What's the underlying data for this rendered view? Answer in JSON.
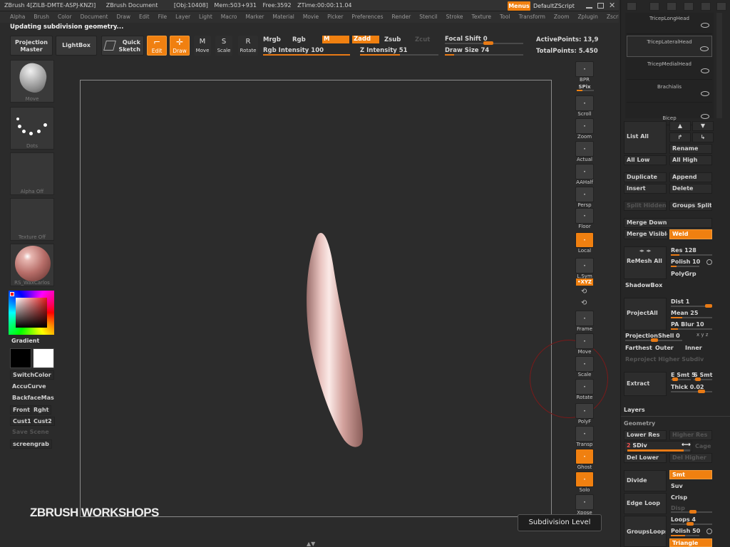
{
  "topbar": {
    "app": "ZBrush 4[ZILB-DMTE-ASPJ-KNZI]",
    "doc": "ZBrush Document",
    "obj": "[Obj:10408]",
    "mem": "Mem:503+931",
    "free": "Free:3592",
    "ztime": "ZTime:00:00:11.04",
    "menus": "Menus",
    "script": "DefaultZScript"
  },
  "menu": [
    "Alpha",
    "Brush",
    "Color",
    "Document",
    "Draw",
    "Edit",
    "File",
    "Layer",
    "Light",
    "Macro",
    "Marker",
    "Material",
    "Movie",
    "Picker",
    "Preferences",
    "Render",
    "Stencil",
    "Stroke",
    "Texture",
    "Tool",
    "Transform",
    "Zoom",
    "Zplugin",
    "Zscript"
  ],
  "status": "Updating subdivision geometry...",
  "toolbar": {
    "projection": "Projection Master",
    "lightbox": "LightBox",
    "quick_sketch": "Quick Sketch",
    "edit": "Edit",
    "draw": "Draw",
    "move": "Move",
    "scale": "Scale",
    "rotate": "Rotate",
    "mrgb": "Mrgb",
    "rgb": "Rgb",
    "m": "M",
    "zadd": "Zadd",
    "zsub": "Zsub",
    "zcut": "Zcut",
    "rgb_intensity": "Rgb Intensity 100",
    "z_intensity": "Z Intensity 51",
    "focal_shift": "Focal Shift 0",
    "draw_size": "Draw Size 74",
    "active_points": "ActivePoints: 13,9",
    "total_points": "TotalPoints: 5.450",
    "rgb_intensity_level": 1.0,
    "z_intensity_level": 0.51,
    "draw_size_level": 0.12
  },
  "left": {
    "brush": "Move",
    "stroke": "Dots",
    "alpha": "Alpha Off",
    "texture": "Texture Off",
    "material": "RS_WaxCarlos",
    "gradient": "Gradient",
    "switch_color": "SwitchColor",
    "accucurve": "AccuCurve",
    "backface": "BackfaceMas",
    "front": "Front",
    "right": "Rght",
    "cust1": "Cust1",
    "cust2": "Cust2",
    "save_scene": "Save Scene",
    "screengrab": "screengrab"
  },
  "right_tools": [
    {
      "label": "BPR",
      "icon": "bpr-icon",
      "orange": false
    },
    {
      "label": "SPix",
      "icon": "spix-icon",
      "orange": false
    },
    {
      "label": "Scroll",
      "icon": "scroll-hand-icon",
      "orange": false
    },
    {
      "label": "Zoom",
      "icon": "zoom-icon",
      "orange": false
    },
    {
      "label": "Actual",
      "icon": "actual-icon",
      "orange": false
    },
    {
      "label": "AAHalf",
      "icon": "aahalf-icon",
      "orange": false
    },
    {
      "label": "Persp",
      "icon": "persp-icon",
      "orange": false
    },
    {
      "label": "Floor",
      "icon": "floor-icon",
      "orange": false
    },
    {
      "label": "Local",
      "icon": "local-icon",
      "orange": true
    },
    {
      "label": "L.Sym",
      "icon": "lsym-icon",
      "orange": false
    },
    {
      "label": "Frame",
      "icon": "frame-icon",
      "orange": false
    },
    {
      "label": "Move",
      "icon": "move-hand-icon",
      "orange": false
    },
    {
      "label": "Scale",
      "icon": "scale-icon",
      "orange": false
    },
    {
      "label": "Rotate",
      "icon": "rotate-icon",
      "orange": false
    },
    {
      "label": "PolyF",
      "icon": "polyf-icon",
      "orange": false
    },
    {
      "label": "Transp",
      "icon": "transp-icon",
      "orange": false
    },
    {
      "label": "Ghost",
      "icon": "ghost-icon",
      "orange": true
    },
    {
      "label": "Solo",
      "icon": "solo-icon",
      "orange": true
    },
    {
      "label": "Xpose",
      "icon": "xpose-icon",
      "orange": false
    }
  ],
  "xyz": "•XYZ",
  "subtools": [
    "TricepLongHead",
    "TricepLateralHead",
    "TricepMedialHead",
    "Brachialis",
    "Bicep"
  ],
  "panel": {
    "list_all": "List All",
    "rename": "Rename",
    "all_low": "All Low",
    "all_high": "All High",
    "duplicate": "Duplicate",
    "append": "Append",
    "insert": "Insert",
    "delete": "Delete",
    "split_hidden": "Split Hidden",
    "groups_split": "Groups Split",
    "merge_down": "Merge Down",
    "merge_visible": "Merge Visible",
    "weld": "Weld",
    "remesh_all": "ReMesh All",
    "res": "Res 128",
    "polish": "Polish 10",
    "polygrp": "PolyGrp",
    "shadowbox": "ShadowBox",
    "project_all": "ProjectAll",
    "dist": "Dist 1",
    "mean": "Mean 25",
    "pa_blur": "PA Blur 10",
    "projection_shell": "ProjectionShell 0",
    "farthest": "Farthest",
    "outer": "Outer",
    "inner": "Inner",
    "reproject": "Reproject Higher Subdiv",
    "extract": "Extract",
    "e_smt": "E Smt 5",
    "s_smt": "S Smt",
    "thick": "Thick 0.02",
    "layers": "Layers",
    "geometry": "Geometry",
    "lower_res": "Lower Res",
    "higher_res": "Higher Res",
    "sdiv": "SDiv",
    "sdiv_value": "2",
    "cage": "Cage",
    "del_lower": "Del Lower",
    "del_higher": "Del Higher",
    "divide": "Divide",
    "smt": "Smt",
    "suv": "Suv",
    "edge_loop": "Edge Loop",
    "crisp": "Crisp",
    "disp": "Disp",
    "groups_loops": "GroupsLoops",
    "loops": "Loops 4",
    "polish50": "Polish 50",
    "triangle": "Triangle",
    "sdiv_level": 0.9
  },
  "tooltip": "Subdivision Level",
  "watermark": "ZBRUSH WORKSHOPS",
  "colors": {
    "accent": "#f08010",
    "bg": "#2b2b2b",
    "panel": "#262626"
  }
}
